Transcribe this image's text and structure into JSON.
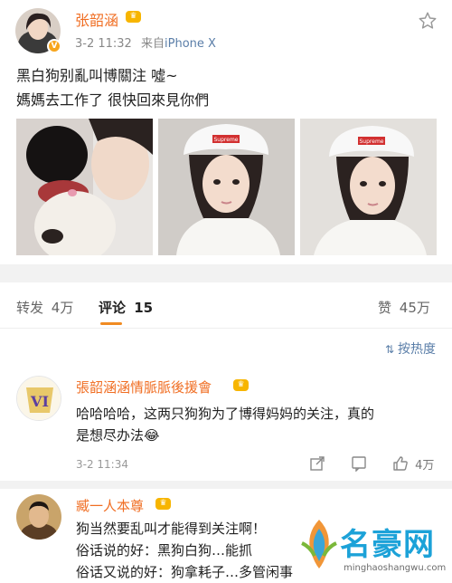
{
  "post": {
    "author": "张韶涵",
    "time": "3-2 11:32",
    "source_prefix": "来自",
    "device": "iPhone X",
    "line1": "黑白狗别亂叫博關注 噓~",
    "line2": "媽媽去工作了 很快回來見你們",
    "cap_text": "Supreme",
    "colors": {
      "author": "#f06e23",
      "accent": "#f08b22",
      "link": "#5a7ea8"
    }
  },
  "tabs": {
    "repost_label": "转发",
    "repost_count": "4万",
    "comment_label": "评论",
    "comment_count": "15",
    "like_label": "赞",
    "like_count": "45万"
  },
  "sort": {
    "label": "按热度",
    "icon": "sort-icon"
  },
  "comments": [
    {
      "name": "張韶涵涵情脈脈後援會",
      "text1": "哈哈哈哈，这两只狗狗为了博得妈妈的关注，真的",
      "text2": "是想尽办法",
      "emoji": "😂",
      "time": "3-2 11:34",
      "likes": "4万"
    },
    {
      "name": "臧一人本尊",
      "text1": "狗当然要乱叫才能得到关注啊！",
      "text2": "俗话说的好：黑狗白狗…能抓",
      "text3": "俗话又说的好：狗拿耗子…多管闲事"
    }
  ],
  "watermark": {
    "brand": "名豪网",
    "url": "minghaoshangwu.com"
  }
}
